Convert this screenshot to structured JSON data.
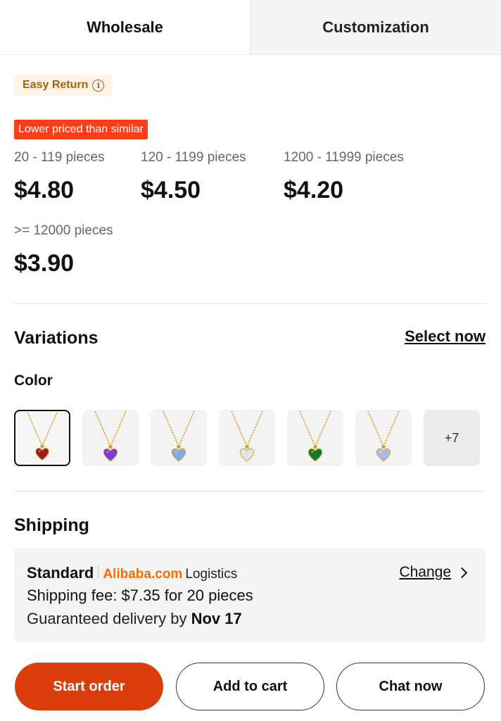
{
  "tabs": [
    {
      "label": "Wholesale",
      "active": true
    },
    {
      "label": "Customization",
      "active": false
    }
  ],
  "badges": {
    "easy_return": "Easy Return",
    "lower_priced": "Lower priced than similar"
  },
  "price_tiers": [
    {
      "range": "20 - 119 pieces",
      "price": "$4.80"
    },
    {
      "range": "120 - 1199 pieces",
      "price": "$4.50"
    },
    {
      "range": "1200 - 11999 pieces",
      "price": "$4.20"
    },
    {
      "range": ">= 12000 pieces",
      "price": "$3.90"
    }
  ],
  "variations": {
    "title": "Variations",
    "select_label": "Select now",
    "color_label": "Color",
    "swatches": [
      {
        "name": "red-heart-necklace",
        "gem_color": "#9c1a22",
        "selected": true
      },
      {
        "name": "purple-heart-necklace",
        "gem_color": "#7a3bd6",
        "selected": false
      },
      {
        "name": "light-blue-heart-necklace",
        "gem_color": "#7fa9e8",
        "selected": false
      },
      {
        "name": "white-heart-necklace",
        "gem_color": "#dfe6ec",
        "selected": false
      },
      {
        "name": "green-heart-necklace",
        "gem_color": "#0f7a2e",
        "selected": false
      },
      {
        "name": "lavender-heart-necklace",
        "gem_color": "#a9b9ee",
        "selected": false
      }
    ],
    "more_label": "+7"
  },
  "shipping": {
    "title": "Shipping",
    "method": "Standard",
    "provider_brand": "Alibaba.com",
    "provider_suffix": "Logistics",
    "change_label": "Change",
    "fee_text": "Shipping fee: $7.35 for 20 pieces",
    "delivery_prefix": "Guaranteed delivery by",
    "delivery_date": "Nov 17"
  },
  "actions": {
    "start_order": "Start order",
    "add_to_cart": "Add to cart",
    "chat_now": "Chat now"
  },
  "colors": {
    "primary": "#dc3e0b",
    "badge_red": "#ff3d17",
    "brand_orange": "#ff6a00",
    "easy_return_text": "#a8620f",
    "chain_gold": "#d9a521"
  }
}
